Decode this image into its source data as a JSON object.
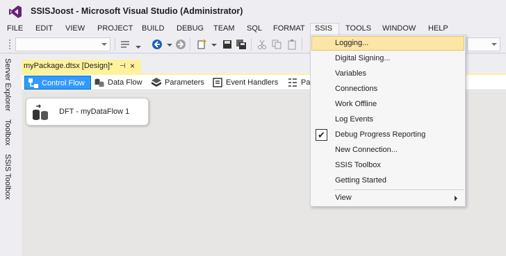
{
  "window": {
    "title": "SSISJoost - Microsoft Visual Studio (Administrator)"
  },
  "menubar": {
    "items": [
      "FILE",
      "EDIT",
      "VIEW",
      "PROJECT",
      "BUILD",
      "DEBUG",
      "TEAM",
      "SQL",
      "FORMAT",
      "SSIS",
      "TOOLS",
      "WINDOW",
      "HELP"
    ],
    "open_menu": "SSIS"
  },
  "sidebar": {
    "tabs": [
      "Server Explorer",
      "Toolbox",
      "SSIS Toolbox"
    ]
  },
  "document": {
    "tab_title": "myPackage.dtsx [Design]*",
    "pin_glyph": "⊣",
    "close_glyph": "×"
  },
  "designer_tabs": [
    {
      "label": "Control Flow",
      "icon": "control-flow-icon",
      "active": true
    },
    {
      "label": "Data Flow",
      "icon": "data-flow-icon",
      "active": false
    },
    {
      "label": "Parameters",
      "icon": "parameters-icon",
      "active": false
    },
    {
      "label": "Event Handlers",
      "icon": "event-handlers-icon",
      "active": false
    },
    {
      "label": "Pa",
      "icon": "package-explorer-icon",
      "active": false
    }
  ],
  "canvas": {
    "task_label": "DFT - myDataFlow 1",
    "task_icon": "data-flow-task-icon"
  },
  "ssis_menu": {
    "items": [
      {
        "label": "Logging...",
        "highlighted": true
      },
      {
        "label": "Digital Signing..."
      },
      {
        "label": "Variables"
      },
      {
        "label": "Connections"
      },
      {
        "label": "Work Offline"
      },
      {
        "label": "Log Events"
      },
      {
        "label": "Debug Progress Reporting",
        "checked": true
      },
      {
        "label": "New Connection..."
      },
      {
        "label": "SSIS Toolbox"
      },
      {
        "label": "Getting Started"
      },
      {
        "label": "View",
        "submenu": true
      }
    ],
    "check_glyph": "✔"
  },
  "colors": {
    "accent": "#007acc",
    "active_tab": "#3399ff",
    "doc_tab": "#fff29d",
    "menu_hover": "#fbe6a8"
  }
}
